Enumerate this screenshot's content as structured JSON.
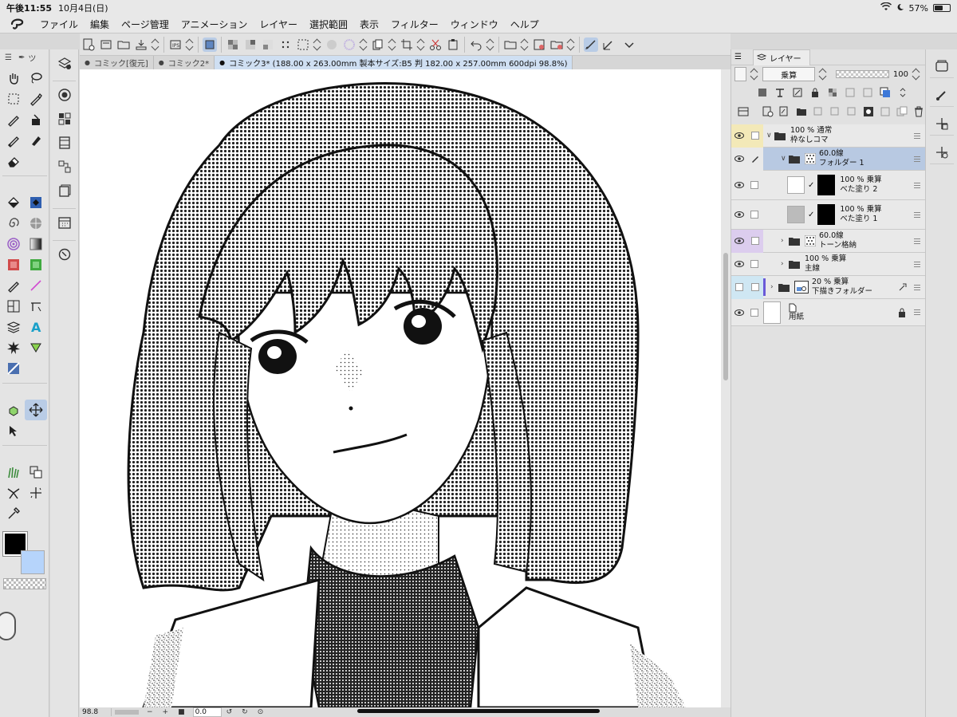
{
  "status": {
    "time": "午後11:55",
    "date": "10月4日(日)",
    "battery": "57%",
    "battery_level": 0.57
  },
  "menu": [
    "ファイル",
    "編集",
    "ページ管理",
    "アニメーション",
    "レイヤー",
    "選択範囲",
    "表示",
    "フィルター",
    "ウィンドウ",
    "ヘルプ"
  ],
  "tool_tabs": "ツ",
  "doc_tabs": [
    {
      "label": "コミック[復元]"
    },
    {
      "label": "コミック2*"
    },
    {
      "label": "コミック3* (188.00 x 263.00mm 製本サイズ:B5 判 182.00 x 257.00mm 600dpi 98.8%)"
    }
  ],
  "bottom": {
    "zoom": "98.8",
    "minus": "−",
    "plus": "+",
    "angle": "0.0"
  },
  "layer_panel": {
    "tab": "レイヤー",
    "blend_mode": "乗算",
    "opacity": "100",
    "layers": [
      {
        "pct": "100 % 通常",
        "name": "枠なしコマ"
      },
      {
        "pct": "60.0線",
        "name": "フォルダー 1"
      },
      {
        "pct": "100 % 乗算",
        "name": "べた塗り 2"
      },
      {
        "pct": "100 % 乗算",
        "name": "べた塗り 1"
      },
      {
        "pct": "60.0線",
        "name": "トーン格納"
      },
      {
        "pct": "100 % 乗算",
        "name": "主線"
      },
      {
        "pct": "20 % 乗算",
        "name": "下描きフォルダー"
      },
      {
        "pct": "",
        "name": "用紙"
      }
    ]
  },
  "colors": {
    "main": "#000000",
    "sub": "#b6d4fb",
    "accent": "#b9cce6"
  }
}
